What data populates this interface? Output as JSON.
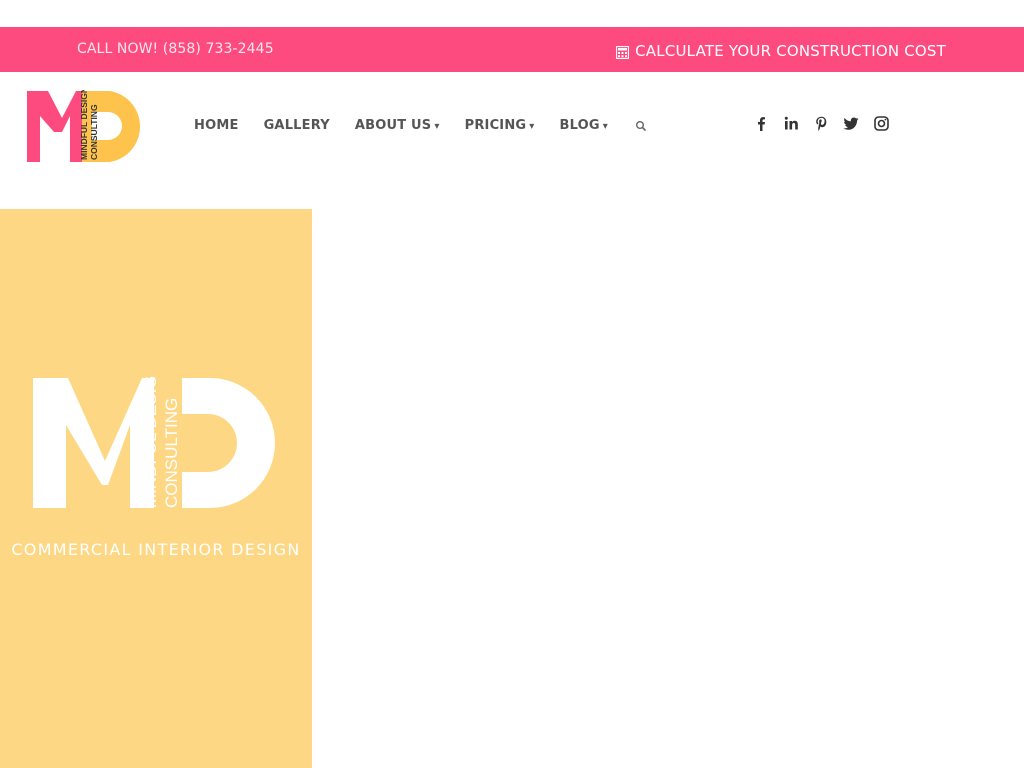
{
  "topbar": {
    "call_text": "CALL NOW! (858) 733-2445",
    "calculator_label": "CALCULATE YOUR CONSTRUCTION COST",
    "calculator_icon": "calculator-icon",
    "background_color": "#fd4a7f"
  },
  "logo": {
    "line1": "MINDFUL DESIGN",
    "line2": "CONSULTING",
    "pink": "#fd4a7f",
    "yellow": "#fdc34d"
  },
  "nav": {
    "items": [
      {
        "label": "HOME",
        "has_dropdown": false
      },
      {
        "label": "GALLERY",
        "has_dropdown": false
      },
      {
        "label": "ABOUT US",
        "has_dropdown": true
      },
      {
        "label": "PRICING",
        "has_dropdown": true
      },
      {
        "label": "BLOG",
        "has_dropdown": true
      }
    ],
    "caret": "▾",
    "search_icon": "search-icon"
  },
  "social": [
    "facebook-icon",
    "linkedin-icon",
    "pinterest-icon",
    "twitter-icon",
    "instagram-icon"
  ],
  "hero": {
    "logo_line1": "MINDFUL DESIGN",
    "logo_line2": "CONSULTING",
    "tagline": "COMMERCIAL INTERIOR DESIGN",
    "background_color": "#fdd784"
  }
}
